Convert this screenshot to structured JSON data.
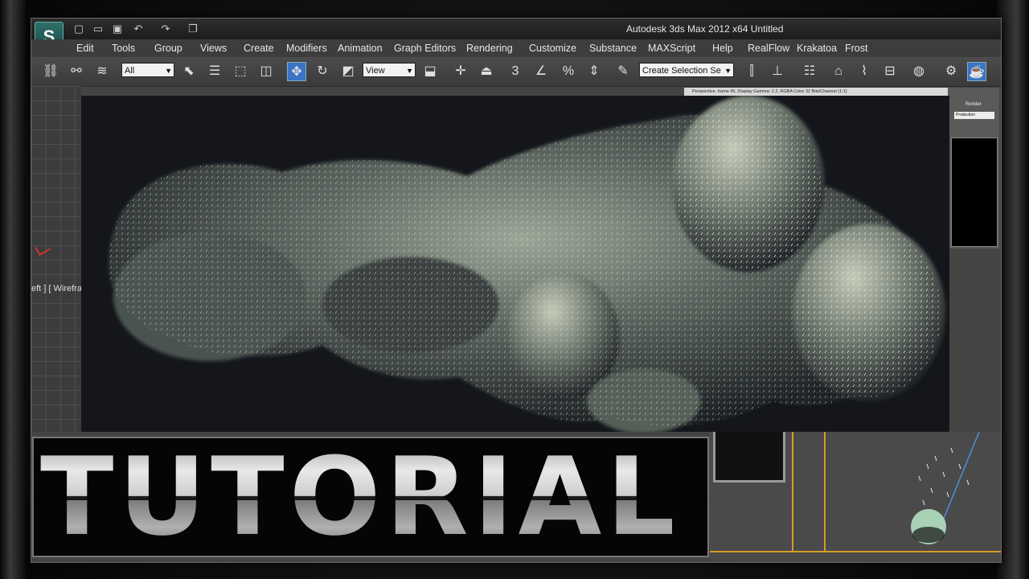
{
  "window": {
    "title": "Autodesk 3ds Max  2012 x64      Untitled",
    "app_logo": "S"
  },
  "menubar": {
    "items": [
      "Edit",
      "Tools",
      "Group",
      "Views",
      "Create",
      "Modifiers",
      "Animation",
      "Graph Editors",
      "Rendering",
      "Customize",
      "Substance",
      "MAXScript",
      "Help",
      "RealFlow",
      "Krakatoa",
      "Frost"
    ]
  },
  "toolbar": {
    "selection_filter": "All",
    "reference_coord": "View",
    "named_selection_placeholder": "Create Selection Se",
    "snap_label": "3",
    "percent_snap": "%"
  },
  "viewport": {
    "label": "eft ] [ Wirefra"
  },
  "render_frame": {
    "header": "Perspective, frame 45, Display Gamma: 2.2, RGBA Color 32 Bits/Channel (1:1)"
  },
  "render_panel": {
    "render_label": "Render",
    "preset": "Production"
  },
  "overlay": {
    "title": "TUTORIAL"
  },
  "colors": {
    "accent_blue": "#3b74c4",
    "orange_guides": "#d89a2a",
    "sphere": "#a9d1b5"
  }
}
